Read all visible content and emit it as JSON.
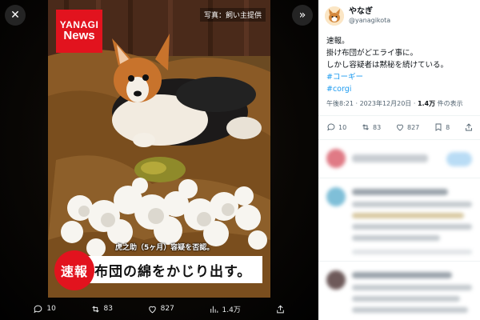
{
  "viewer": {
    "close_icon": "close-icon",
    "collapse_icon": "chevrons-right-icon",
    "photo": {
      "brand_top": "YANAGI",
      "brand_bottom": "News",
      "credit": "写真：飼い主提供",
      "caption_sub": "虎之助（5ヶ月）容疑を否認。",
      "badge": "速報",
      "caption_main": "布団の綿をかじり出す。"
    },
    "actions": {
      "replies": "10",
      "retweets": "83",
      "likes": "827",
      "views": "1.4万"
    }
  },
  "tweet": {
    "display_name": "やなぎ",
    "handle": "@yanagikota",
    "lines": [
      "速報。",
      "掛け布団がどエライ事に。",
      "しかし容疑者は黙秘を続けている。"
    ],
    "hashtags": [
      "#コーギー",
      "#corgi"
    ],
    "time": "午後8:21 · 2023年12月20日 · ",
    "views_count": "1.4万",
    "views_label": " 件の表示",
    "stats": {
      "replies": "10",
      "retweets": "83",
      "likes": "827",
      "bookmarks": "8"
    }
  },
  "colors": {
    "accent": "#1d9bf0",
    "breaking_red": "#e2131e",
    "text_secondary": "#536471"
  }
}
